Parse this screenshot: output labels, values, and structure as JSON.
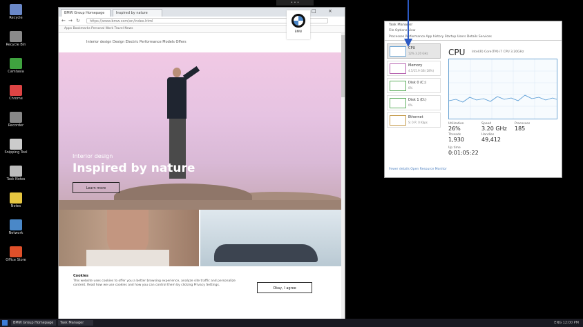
{
  "desktop": {
    "icons": [
      {
        "label": "Recycle",
        "color": "#6a88c8",
        "icon": "folder-icon"
      },
      {
        "label": "Recycle Bin",
        "color": "#8a8a8a",
        "icon": "recycle-bin-icon"
      },
      {
        "label": "Camtasia",
        "color": "#3fa33f",
        "icon": "camtasia-icon"
      },
      {
        "label": "Chrome",
        "color": "#d44",
        "icon": "chrome-icon"
      },
      {
        "label": "Recorder",
        "color": "#888",
        "icon": "recorder-icon"
      },
      {
        "label": "Snipping Tool",
        "color": "#ccc",
        "icon": "snipping-tool-icon"
      },
      {
        "label": "Task Notes",
        "color": "#bbb",
        "icon": "notes-icon"
      },
      {
        "label": "Notes",
        "color": "#e6c640",
        "icon": "file-icon"
      },
      {
        "label": "Network",
        "color": "#4a88c8",
        "icon": "network-icon"
      },
      {
        "label": "Office Store",
        "color": "#e0502a",
        "icon": "office-icon"
      }
    ]
  },
  "browser": {
    "tabs": [
      {
        "label": "BMW Group Homepage"
      },
      {
        "label": "Inspired by nature"
      }
    ],
    "url": "https://www.bmw.com/en/index.html",
    "bookmarks": "Apps   Bookmarks   Personal   Work   Travel   News",
    "site_nav": "Interior design   Design   Electric   Performance   Models   Offers",
    "brand_sub": "BMW",
    "hero": {
      "small": "Interior design",
      "big": "Inspired by nature",
      "button": "Learn more"
    },
    "cookie": {
      "title": "Cookies",
      "text": "This website uses cookies to offer you a better browsing experience, analyze site traffic and personalize content. Read how we use cookies and how you can control them by clicking Privacy Settings.",
      "button": "Okay, I agree"
    }
  },
  "taskmanager": {
    "title": "Task Manager",
    "menu": "File   Options   View",
    "tabs": "Processes   Performance   App history   Startup   Users   Details   Services",
    "items": [
      {
        "name": "CPU",
        "sub": "12% 3.20 GHz",
        "color": "#6fa6d4"
      },
      {
        "name": "Memory",
        "sub": "4.5/15.9 GB (28%)",
        "color": "#b45fae"
      },
      {
        "name": "Disk 0 (C:)",
        "sub": "0%",
        "color": "#5fae5f"
      },
      {
        "name": "Disk 1 (D:)",
        "sub": "0%",
        "color": "#5fae5f"
      },
      {
        "name": "Ethernet",
        "sub": "S: 0 R: 0 Kbps",
        "color": "#c49a4a"
      }
    ],
    "cpu_title": "CPU",
    "cpu_model": "Intel(R) Core(TM) i7 CPU 3.20GHz",
    "stats": [
      {
        "label": "Utilization",
        "value": "26%"
      },
      {
        "label": "Speed",
        "value": "3.20 GHz"
      },
      {
        "label": "Processes",
        "value": "185"
      },
      {
        "label": "Threads",
        "value": "1,930"
      },
      {
        "label": "Handles",
        "value": "49,412"
      }
    ],
    "uptime_label": "Up time",
    "uptime": "0:01:05:22",
    "footer": "Fewer details   Open Resource Monitor"
  },
  "taskbar": {
    "buttons": [
      {
        "label": "BMW Group Homepage"
      },
      {
        "label": "Task Manager"
      }
    ],
    "tray": "ENG  12:00 PM"
  },
  "top_ctrl": "• • •"
}
